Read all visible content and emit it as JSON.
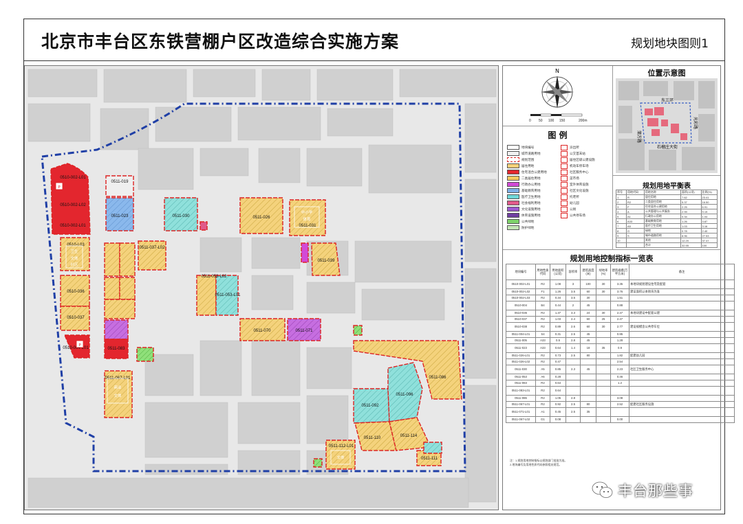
{
  "header": {
    "title": "北京市丰台区东铁营棚户区改造综合实施方案",
    "sheet": "规划地块图则1"
  },
  "map": {
    "parcels": [
      {
        "id": "0510-002-L01",
        "label": "0510-002-L01",
        "use": "residential-red"
      },
      {
        "id": "0510-002-L02",
        "label": "0510-002-L02",
        "use": "residential-red"
      },
      {
        "id": "0510-004",
        "label": "0510-004",
        "use": "residential-red"
      },
      {
        "id": "0510-L03",
        "label": "0510-L03",
        "use": "public-yellow"
      },
      {
        "id": "0510-036",
        "label": "0510-036",
        "use": "public-yellow"
      },
      {
        "id": "0510-037",
        "label": "0510-037",
        "use": "public-yellow"
      },
      {
        "id": "0510-038",
        "label": "0510-038",
        "use": "public-yellow"
      },
      {
        "id": "0511-019",
        "label": "0511-019",
        "use": "outline"
      },
      {
        "id": "0511-023",
        "label": "0511-023",
        "use": "school-blue"
      },
      {
        "id": "0511-030",
        "label": "0511-030",
        "use": "medical-cyan"
      },
      {
        "id": "0511-026",
        "label": "0511-026",
        "use": "public-yellow"
      },
      {
        "id": "0511-031",
        "label": "0511-031",
        "use": "public-yellow"
      },
      {
        "id": "0511-039",
        "label": "0511-039",
        "use": "public-yellow"
      },
      {
        "id": "0511-053",
        "label": "0511-053-L01",
        "use": "medical-cyan"
      },
      {
        "id": "0511-070",
        "label": "0511-070",
        "use": "public-yellow"
      },
      {
        "id": "0511-071",
        "label": "0511-071",
        "use": "purple"
      },
      {
        "id": "0511-083",
        "label": "0511-083",
        "use": "residential-red"
      },
      {
        "id": "0511-086",
        "label": "0511-086",
        "use": "public-yellow"
      },
      {
        "id": "0511-092",
        "label": "0511-092",
        "use": "medical-cyan"
      },
      {
        "id": "0511-096",
        "label": "0511-096",
        "use": "medical-cyan"
      },
      {
        "id": "0511-110",
        "label": "0511-110",
        "use": "public-yellow"
      },
      {
        "id": "0511-114",
        "label": "0511-114",
        "use": "public-yellow"
      },
      {
        "id": "0511-111",
        "label": "0511-111",
        "use": "public-yellow"
      }
    ],
    "block_tags": [
      "中小学",
      "卫生",
      "文体",
      "体育",
      "商业",
      "社区"
    ]
  },
  "legend": {
    "title": "图 例",
    "left": [
      {
        "label": "地块编号",
        "color": "#ffffff"
      },
      {
        "label": "城市道路用地",
        "color": "#f2f2f2"
      },
      {
        "label": "规划范围",
        "color": "#ffffff"
      },
      {
        "label": "居住用地",
        "color": "#f7d17a"
      },
      {
        "label": "住宅混合公建用地",
        "color": "#e3262e"
      },
      {
        "label": "二类居住用地",
        "color": "#f5c85f"
      },
      {
        "label": "行政办公用地",
        "color": "#d24ad6"
      },
      {
        "label": "基础教育用地",
        "color": "#7fb0e8"
      },
      {
        "label": "医疗卫生用地",
        "color": "#6fd8d8"
      },
      {
        "label": "社会福利用地",
        "color": "#e05a8a"
      },
      {
        "label": "文化设施用地",
        "color": "#9b59d0"
      },
      {
        "label": "体育设施用地",
        "color": "#6f3fa0"
      },
      {
        "label": "公共绿地",
        "color": "#7ed36a"
      },
      {
        "label": "防护绿地",
        "color": "#c4e6b5"
      }
    ],
    "right": [
      {
        "label": "派出所",
        "color": "#ffffff"
      },
      {
        "label": "公交首末站",
        "color": "#ffffff"
      },
      {
        "label": "居住区级公建设施",
        "color": "#ffffff"
      },
      {
        "label": "机动车停车场",
        "color": "#ffffff"
      },
      {
        "label": "社区服务中心",
        "color": "#ffffff"
      },
      {
        "label": "菜市场",
        "color": "#ffffff"
      },
      {
        "label": "室外体育设施",
        "color": "#ffffff"
      },
      {
        "label": "社区文化设施",
        "color": "#ffffff"
      },
      {
        "label": "托老所",
        "color": "#ffffff"
      },
      {
        "label": "幼儿园",
        "color": "#ffffff"
      },
      {
        "label": "公厕",
        "color": "#ffffff"
      },
      {
        "label": "公共停车场",
        "color": "#ffffff"
      }
    ]
  },
  "scale": {
    "labels": [
      "0",
      "50",
      "100",
      "150",
      "200m"
    ],
    "north": "N"
  },
  "location_map": {
    "title": "位置示意图",
    "labels": [
      "东三环",
      "蒲方路",
      "石榴庄大街",
      "光彩路"
    ]
  },
  "balance_table": {
    "title": "规划用地平衡表",
    "rows": [
      [
        "序号",
        "用地代码",
        "用地名称",
        "面积(公顷)",
        "比例(%)"
      ],
      [
        "1",
        "R",
        "居住用地",
        "7.62",
        "23.41"
      ],
      [
        "2",
        "R2",
        "二类居住用地",
        "5.37",
        "16.50"
      ],
      [
        "3",
        "F",
        "住宅混合公建用地",
        "2.25",
        "6.91"
      ],
      [
        "4",
        "A",
        "公共管理与公共服务",
        "2.99",
        "9.19"
      ],
      [
        "5",
        "A1",
        "行政办公用地",
        "0.34",
        "1.04"
      ],
      [
        "6",
        "A33",
        "基础教育用地",
        "1.26",
        "3.87"
      ],
      [
        "7",
        "A5",
        "医疗卫生用地",
        "1.03",
        "3.16"
      ],
      [
        "8",
        "G",
        "绿地",
        "0.78",
        "2.40"
      ],
      [
        "9",
        "S",
        "城市道路用地",
        "8.96",
        "27.53"
      ],
      [
        "10",
        "",
        "其他",
        "12.20",
        "37.47"
      ],
      [
        "",
        "",
        "合计",
        "32.55",
        "100"
      ]
    ]
  },
  "control_table": {
    "title": "规划用地控制指标一览表",
    "headers": [
      "地块编号",
      "用地性质代码",
      "用地面积(公顷)",
      "容积率",
      "建筑高度(米)",
      "绿地率(%)",
      "建筑规模(万平方米)",
      "备注"
    ],
    "rows": [
      [
        "0510-002-L01",
        "R2",
        "1.08",
        "3",
        "100",
        "30",
        "3.35",
        "本地块规划建设住宅及配套"
      ],
      [
        "0510-002-L02",
        "F1",
        "1.26",
        "3.5",
        "60",
        "30",
        "3.76",
        "建设面积以本地块为准"
      ],
      [
        "0510-002-L03",
        "R2",
        "0.34",
        "3.5",
        "30",
        "",
        "1.51",
        ""
      ],
      [
        "0510-004",
        "B4",
        "0.44",
        "2",
        "45",
        "",
        "0.88",
        ""
      ],
      [
        "0510-036",
        "R2",
        "1.37",
        "3.3",
        "24",
        "30",
        "2.47",
        "本地块建设中配套公建"
      ],
      [
        "0510-037",
        "R2",
        "1.03",
        "2.4",
        "60",
        "25",
        "2.47",
        ""
      ],
      [
        "0510-038",
        "R2",
        "0.89",
        "2.6",
        "60",
        "30",
        "2.77",
        "建设规模含公共停车位"
      ],
      [
        "0511-004-L01",
        "S4",
        "0.31",
        "2.5",
        "45",
        "",
        "0.95",
        ""
      ],
      [
        "0511-005",
        "A33",
        "0.5",
        "2.8",
        "45",
        "",
        "1.28",
        ""
      ],
      [
        "0511-023",
        "A33",
        "0.64",
        "1.4",
        "18",
        "35",
        "0.9",
        ""
      ],
      [
        "0511-026-L01",
        "R2",
        "0.73",
        "2.5",
        "80",
        "",
        "1.82",
        "配建幼儿园"
      ],
      [
        "0511-026-L02",
        "R2",
        "0.47",
        "",
        "",
        "",
        "2.54",
        ""
      ],
      [
        "0511-030",
        "A5",
        "0.85",
        "2.3",
        "45",
        "",
        "2.23",
        "社区卫生服务中心"
      ],
      [
        "0511-053",
        "A6",
        "0.28",
        "",
        "",
        "",
        "0.46",
        ""
      ],
      [
        "0511-083",
        "R2",
        "0.64",
        "",
        "",
        "",
        "1.2",
        ""
      ],
      [
        "0511-083-L01",
        "R2",
        "0.64",
        "",
        "",
        "",
        "",
        ""
      ],
      [
        "0511-086",
        "R2",
        "1.05",
        "2.8",
        "",
        "",
        "3.08",
        ""
      ],
      [
        "0511-067-L01",
        "R2",
        "0.92",
        "2.5",
        "80",
        "",
        "2.52",
        "配建社区服务设施"
      ],
      [
        "0511-071-L01",
        "A1",
        "0.45",
        "2.5",
        "35",
        "",
        "",
        ""
      ],
      [
        "0511-067-L02",
        "G1",
        "0.08",
        "",
        "",
        "",
        "0.00",
        ""
      ]
    ]
  },
  "footnotes": [
    "注：1.规划用地控制指标以规划部门批准为准。",
    "2.地块编号及用地性质代码参照相关规范。"
  ],
  "watermark": "丰台那些事",
  "colors": {
    "red": "#e3262e",
    "yellow": "#f5c85f",
    "blue": "#7fb0e8",
    "cyan": "#6fd8d8",
    "purple": "#b65ad6",
    "green": "#7ed36a",
    "boundary": "#1f3fa6"
  }
}
